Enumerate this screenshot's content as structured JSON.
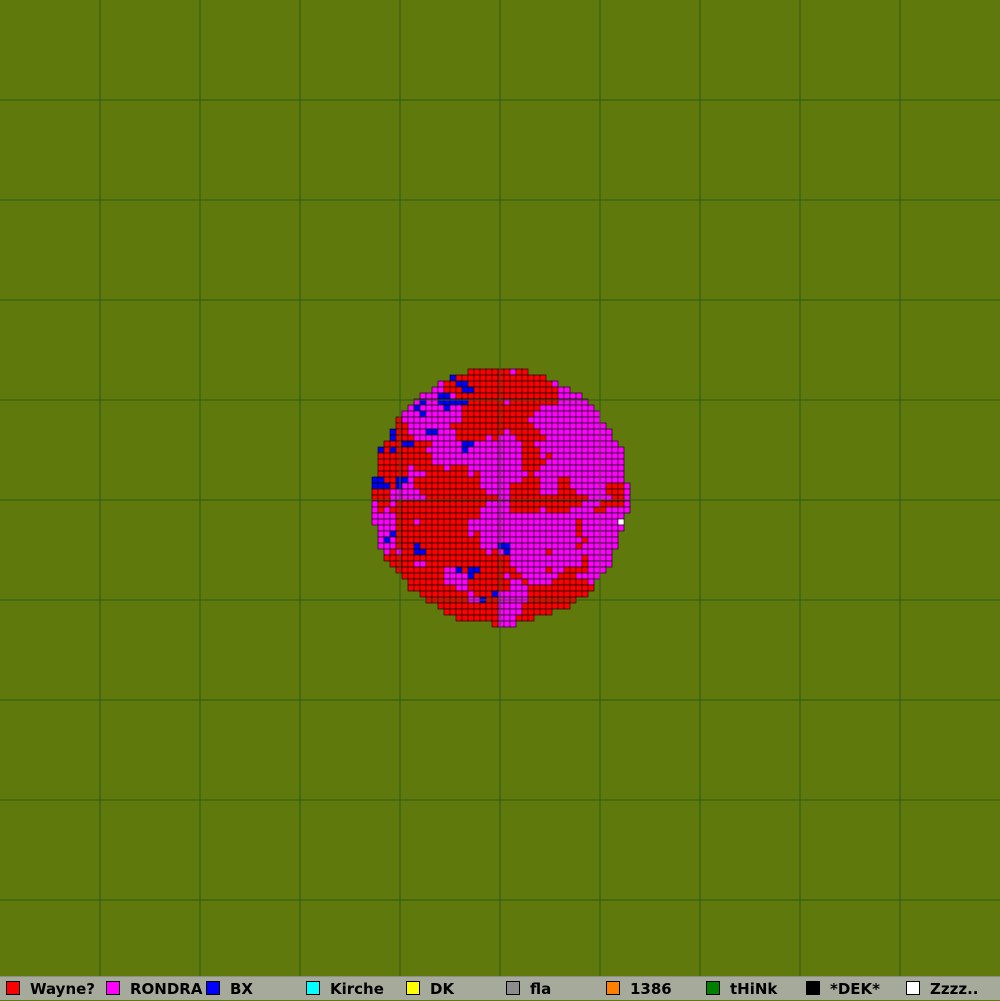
{
  "map": {
    "background_color": "#5f790d",
    "grid_color": "#2e5a12",
    "grid_cells": 10,
    "outline_color": "#000000"
  },
  "players": [
    {
      "name": "Wayne?",
      "color": "#ff0000",
      "share": 0.46
    },
    {
      "name": "RONDRA",
      "color": "#ff00ff",
      "share": 0.49
    },
    {
      "name": "BX",
      "color": "#0000ff",
      "share": 0.045
    },
    {
      "name": "Kirche",
      "color": "#00ffff",
      "share": 0
    },
    {
      "name": "DK",
      "color": "#ffff00",
      "share": 0
    },
    {
      "name": "fla",
      "color": "#8c8c8c",
      "share": 0
    },
    {
      "name": "1386",
      "color": "#ff8000",
      "share": 0
    },
    {
      "name": "tHiNk",
      "color": "#008000",
      "share": 0
    },
    {
      "name": "*DEK*",
      "color": "#000000",
      "share": 0
    },
    {
      "name": "Zzzz..",
      "color": "#ffffff",
      "share": 0.005
    }
  ]
}
